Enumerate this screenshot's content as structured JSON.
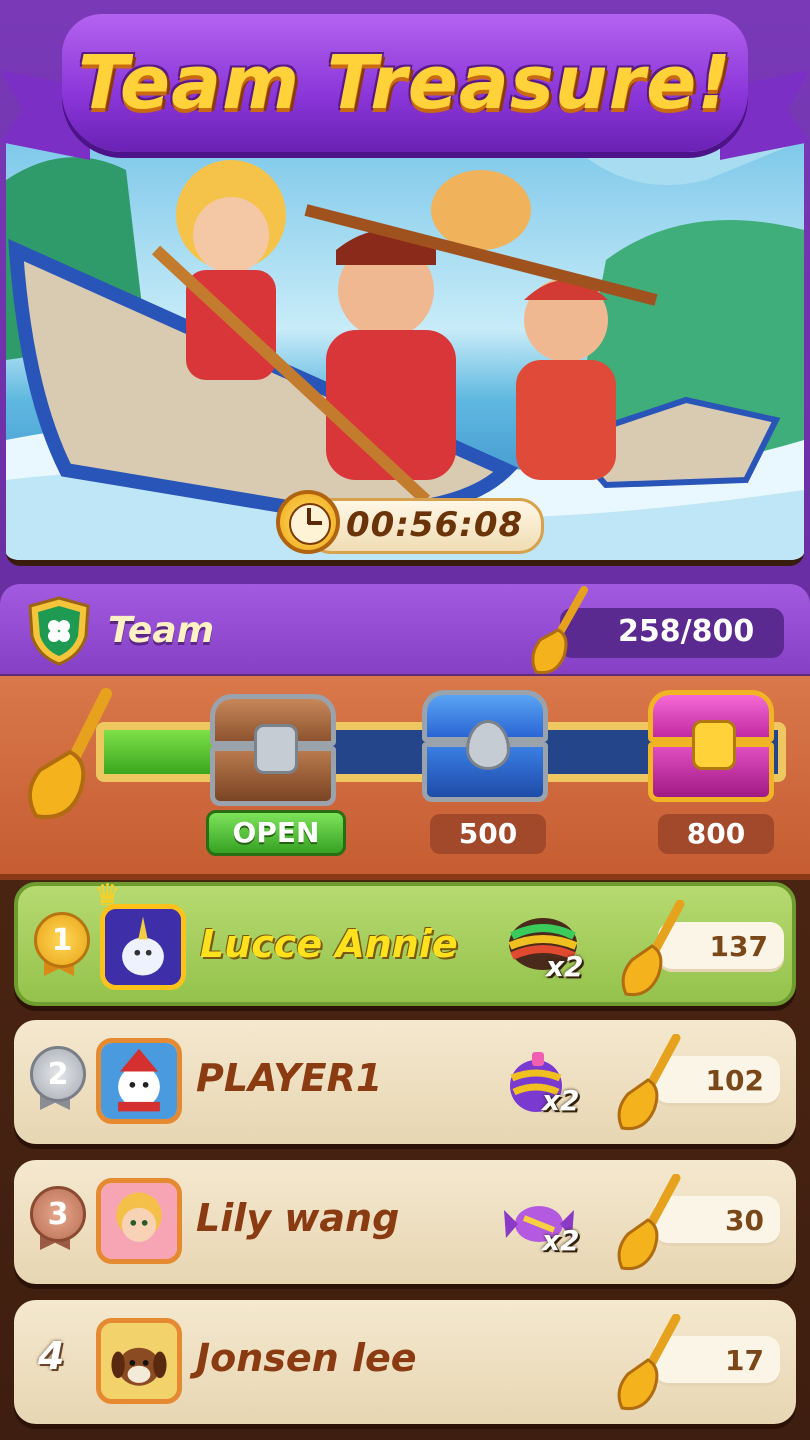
{
  "title": "Team Treasure!",
  "timer": "00:56:08",
  "team": {
    "label": "Team",
    "progress": "258/800",
    "progress_value": 258,
    "progress_max": 800
  },
  "chests": [
    {
      "name": "silver-chest",
      "label": "OPEN"
    },
    {
      "name": "blue-chest",
      "label": "500"
    },
    {
      "name": "pink-chest",
      "label": "800"
    }
  ],
  "players": [
    {
      "rank": "1",
      "name": "Lucce Annie",
      "booster": "x2",
      "booster_icon": "striped-candy-icon",
      "score": "137",
      "avatar_icon": "unicorn-avatar"
    },
    {
      "rank": "2",
      "name": "PLAYER1",
      "booster": "x2",
      "booster_icon": "bomb-candy-icon",
      "score": "102",
      "avatar_icon": "snowman-avatar"
    },
    {
      "rank": "3",
      "name": "Lily wang",
      "booster": "x2",
      "booster_icon": "wrapped-candy-icon",
      "score": "30",
      "avatar_icon": "girl-avatar"
    },
    {
      "rank": "4",
      "name": "Jonsen lee",
      "booster": "",
      "booster_icon": "",
      "score": "17",
      "avatar_icon": "puppy-avatar"
    }
  ],
  "colors": {
    "banner": "#8a35d8",
    "title": "#ffd23a",
    "progress_fill": "#3aa61e",
    "first_row": "#94c24c"
  }
}
